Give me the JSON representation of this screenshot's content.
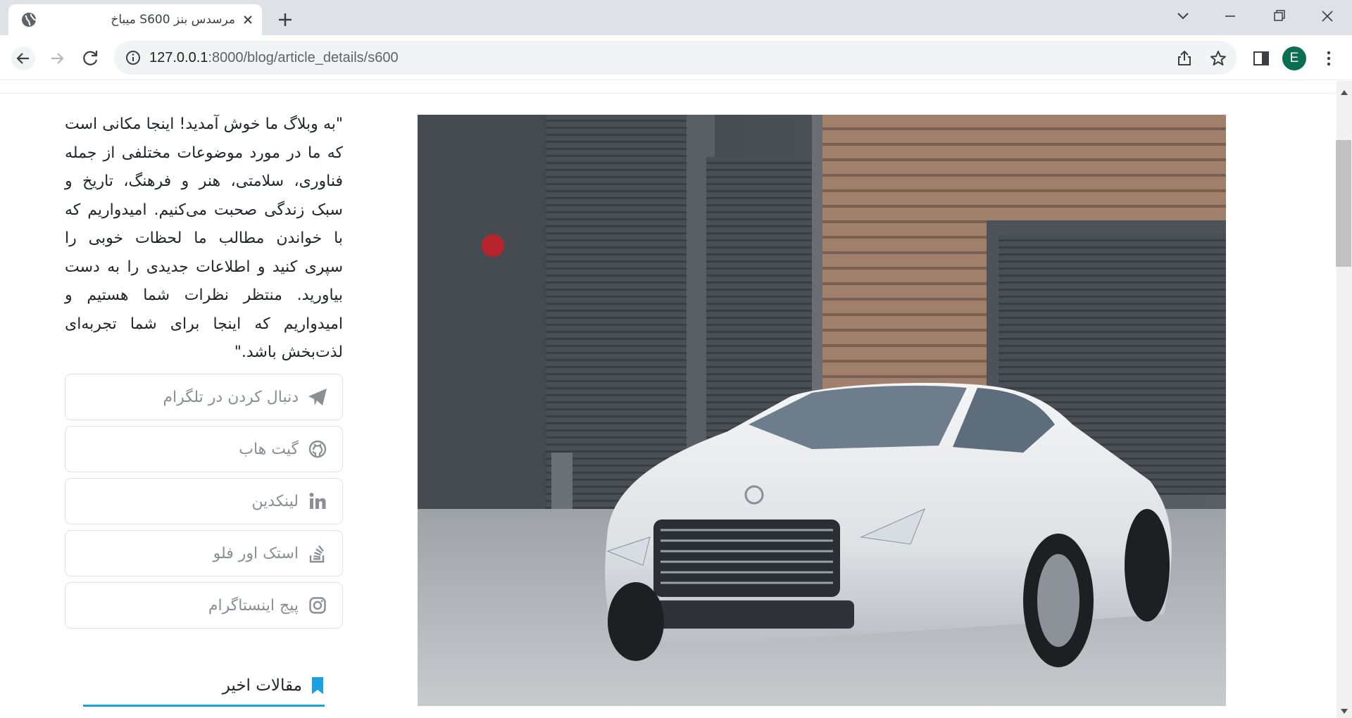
{
  "browser": {
    "tab_title": "مرسدس بنز S600 میباخ",
    "url_host": "127.0.0.1",
    "url_rest": ":8000/blog/article_details/s600",
    "profile_initial": "E",
    "profile_color": "#0b6e4f"
  },
  "icons": {
    "tab_favicon": "globe-icon",
    "tab_close": "close-icon",
    "new_tab": "plus-icon",
    "tab_search": "chevron-down-icon",
    "minimize": "minimize-icon",
    "restore": "restore-icon",
    "close_window": "close-icon",
    "back": "arrow-left-icon",
    "forward": "arrow-right-icon",
    "reload": "reload-icon",
    "site_info": "info-icon",
    "share": "share-icon",
    "bookmark": "star-icon",
    "side_panel": "side-panel-icon",
    "menu": "kebab-menu-icon"
  },
  "article": {
    "image_alt": "Mercedes-Benz S600 Maybach",
    "intro": "\"به وبلاگ ما خوش آمدید! اینجا مکانی است که ما در مورد موضوعات مختلفی از جمله فناوری، سلامتی، هنر و فرهنگ، تاریخ و سبک زندگی صحبت می‌کنیم. امیدواریم که با خواندن مطالب ما لحظات خوبی را سپری کنید و اطلاعات جدیدی را به دست بیاورید. منتظر نظرات شما هستیم و امیدواریم که اینجا برای شما تجربه‌ای لذت‌بخش باشد.\""
  },
  "sidebar": {
    "social": [
      {
        "label": "دنبال کردن در تلگرام",
        "icon": "telegram-icon"
      },
      {
        "label": "گیت هاب",
        "icon": "github-icon"
      },
      {
        "label": "لینکدین",
        "icon": "linkedin-icon"
      },
      {
        "label": "استک اور فلو",
        "icon": "stackoverflow-icon"
      },
      {
        "label": "پیج اینستاگرام",
        "icon": "instagram-icon"
      }
    ],
    "recent_title": "مقالات اخیر",
    "accent_color": "#1aa1e2",
    "muted_text_color": "#8a8f94"
  }
}
